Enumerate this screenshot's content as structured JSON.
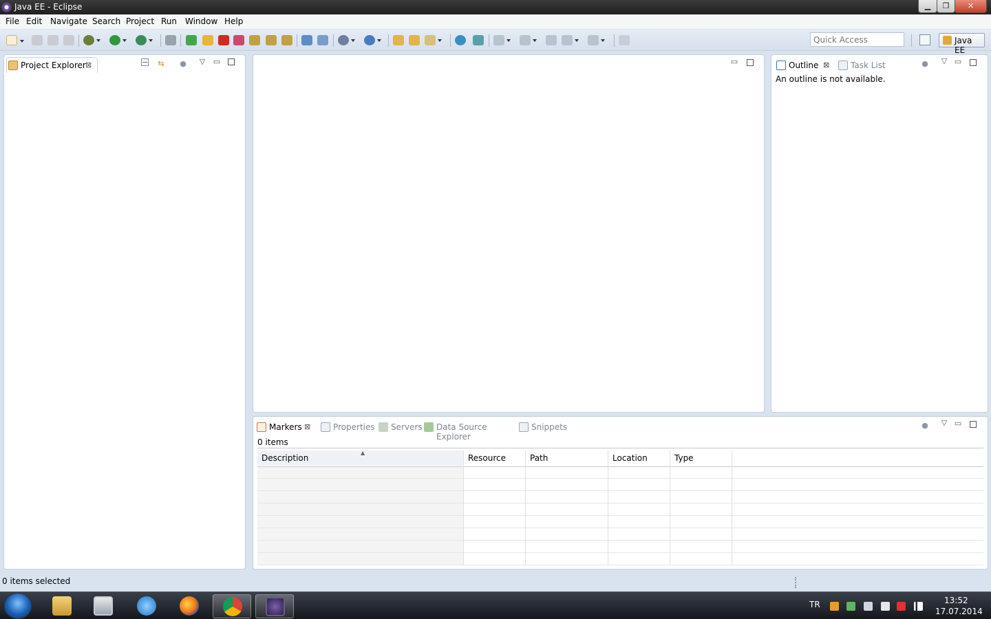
{
  "window": {
    "title": "Java EE - Eclipse"
  },
  "menu": [
    "File",
    "Edit",
    "Navigate",
    "Search",
    "Project",
    "Run",
    "Window",
    "Help"
  ],
  "toolbar": {
    "quick_access_placeholder": "Quick Access",
    "perspective_label": "Java EE"
  },
  "project_explorer": {
    "tab_label": "Project Explorer"
  },
  "outline": {
    "tabs": [
      "Outline",
      "Task List"
    ],
    "message": "An outline is not available."
  },
  "bottom": {
    "tabs": [
      "Markers",
      "Properties",
      "Servers",
      "Data Source Explorer",
      "Snippets"
    ],
    "items_count": "0 items",
    "columns": [
      "Description",
      "Resource",
      "Path",
      "Location",
      "Type"
    ]
  },
  "status": {
    "text": "0 items selected"
  },
  "taskbar": {
    "language": "TR",
    "time": "13:52",
    "date": "17.07.2014",
    "active_app": "Java EE IDE"
  },
  "colors": {
    "workbench_bg": "#d9e3ef",
    "taskbar_bg": "#1c2027",
    "close_button": "#c5402a"
  }
}
